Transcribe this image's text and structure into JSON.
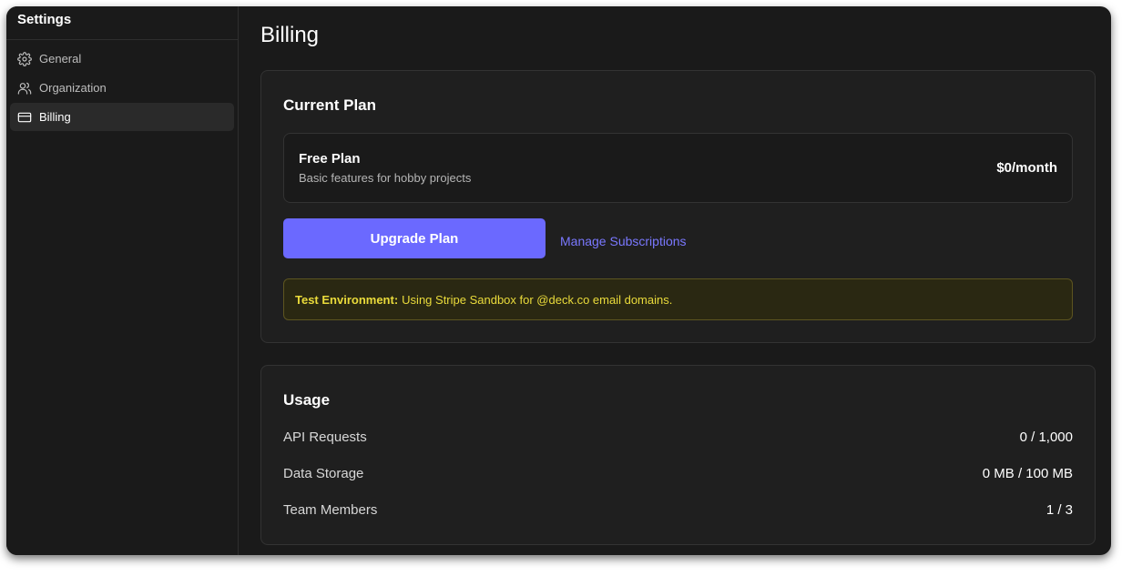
{
  "sidebar": {
    "title": "Settings",
    "items": [
      {
        "label": "General",
        "icon": "gear-icon",
        "active": false
      },
      {
        "label": "Organization",
        "icon": "users-icon",
        "active": false
      },
      {
        "label": "Billing",
        "icon": "credit-card-icon",
        "active": true
      }
    ]
  },
  "page": {
    "title": "Billing"
  },
  "current_plan": {
    "title": "Current Plan",
    "plan_name": "Free Plan",
    "plan_description": "Basic features for hobby projects",
    "price": "$0/month",
    "upgrade_label": "Upgrade Plan",
    "manage_label": "Manage Subscriptions",
    "notice_strong": "Test Environment:",
    "notice_text": "Using Stripe Sandbox for @deck.co email domains."
  },
  "usage": {
    "title": "Usage",
    "rows": [
      {
        "label": "API Requests",
        "value": "0 / 1,000"
      },
      {
        "label": "Data Storage",
        "value": "0 MB / 100 MB"
      },
      {
        "label": "Team Members",
        "value": "1 / 3"
      }
    ]
  },
  "colors": {
    "accent": "#6b69ff",
    "link": "#7a78ff",
    "notice_text": "#eadb3b",
    "background": "#1a1a1a"
  }
}
